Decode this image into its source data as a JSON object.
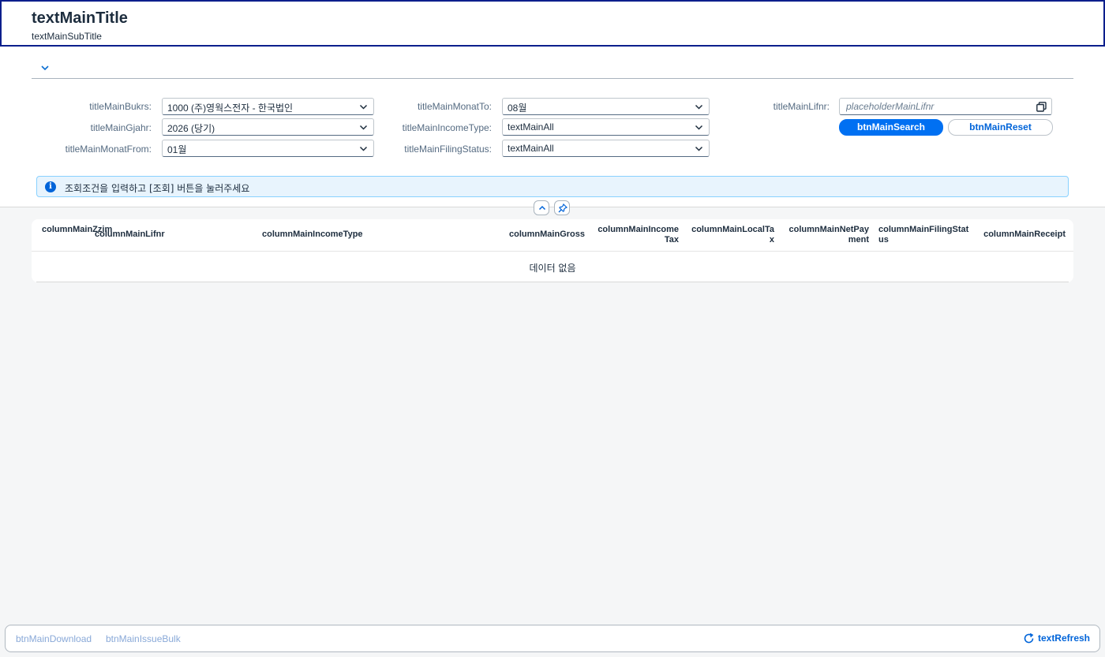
{
  "header": {
    "title": "textMainTitle",
    "subtitle": "textMainSubTitle"
  },
  "filters": {
    "bukrs_label": "titleMainBukrs:",
    "bukrs_value": "1000 (주)영웍스전자 - 한국법인",
    "gjahr_label": "titleMainGjahr:",
    "gjahr_value": "2026 (당기)",
    "monat_from_label": "titleMainMonatFrom:",
    "monat_from_value": "01월",
    "monat_to_label": "titleMainMonatTo:",
    "monat_to_value": "08월",
    "income_type_label": "titleMainIncomeType:",
    "income_type_value": "textMainAll",
    "filing_status_label": "titleMainFilingStatus:",
    "filing_status_value": "textMainAll",
    "lifnr_label": "titleMainLifnr:",
    "lifnr_placeholder": "placeholderMainLifnr",
    "search_label": "btnMainSearch",
    "reset_label": "btnMainReset"
  },
  "message": {
    "text": "조회조건을 입력하고 [조회] 버튼을 눌러주세요"
  },
  "table": {
    "columns": [
      "columnMainZzim",
      "columnMainLifnr",
      "columnMainIncomeType",
      "columnMainGross",
      "columnMainIncomeTax",
      "columnMainLocalTax",
      "columnMainNetPayment",
      "columnMainFilingStatus",
      "columnMainReceipt"
    ],
    "no_data": "데이터 없음"
  },
  "footer": {
    "download_label": "btnMainDownload",
    "issue_bulk_label": "btnMainIssueBulk",
    "refresh_label": "textRefresh"
  },
  "colors": {
    "brand": "#0070f2",
    "title_border": "#0a1e8c",
    "info_bg": "#e8f4fd"
  }
}
